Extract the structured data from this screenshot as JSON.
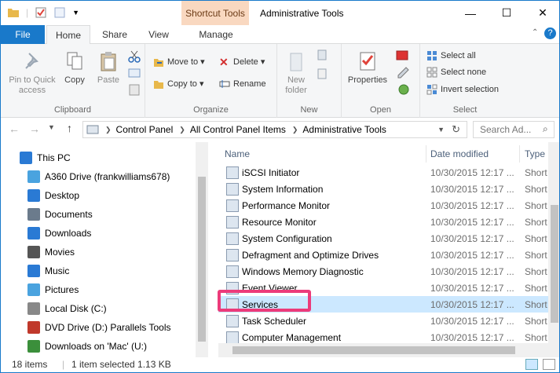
{
  "window": {
    "title": "Administrative Tools",
    "context_tab": "Shortcut Tools",
    "minimize": "—",
    "maximize": "☐",
    "close": "✕"
  },
  "tabs": [
    "File",
    "Home",
    "Share",
    "View",
    "Manage"
  ],
  "ribbon": {
    "clipboard": {
      "label": "Clipboard",
      "pin": "Pin to Quick access",
      "copy": "Copy",
      "paste": "Paste"
    },
    "organize": {
      "label": "Organize",
      "move_to": "Move to ▾",
      "copy_to": "Copy to ▾",
      "delete": "Delete ▾",
      "rename": "Rename"
    },
    "new": {
      "label": "New",
      "new_folder": "New folder"
    },
    "open": {
      "label": "Open",
      "properties": "Properties"
    },
    "select": {
      "label": "Select",
      "select_all": "Select all",
      "select_none": "Select none",
      "invert": "Invert selection"
    }
  },
  "address": {
    "crumbs": [
      "Control Panel",
      "All Control Panel Items",
      "Administrative Tools"
    ],
    "search_placeholder": "Search Ad..."
  },
  "nav": [
    {
      "label": "This PC",
      "icon": "pc-icon"
    },
    {
      "label": "A360 Drive (frankwilliams678)",
      "icon": "cloud-drive-icon"
    },
    {
      "label": "Desktop",
      "icon": "desktop-icon"
    },
    {
      "label": "Documents",
      "icon": "documents-icon"
    },
    {
      "label": "Downloads",
      "icon": "downloads-icon"
    },
    {
      "label": "Movies",
      "icon": "movies-icon"
    },
    {
      "label": "Music",
      "icon": "music-icon"
    },
    {
      "label": "Pictures",
      "icon": "pictures-icon"
    },
    {
      "label": "Local Disk (C:)",
      "icon": "disk-icon"
    },
    {
      "label": "DVD Drive (D:) Parallels Tools",
      "icon": "dvd-icon"
    },
    {
      "label": "Downloads on 'Mac' (U:)",
      "icon": "network-drive-icon"
    }
  ],
  "columns": {
    "name": "Name",
    "date": "Date modified",
    "type": "Type"
  },
  "files": [
    {
      "name": "iSCSI Initiator",
      "date": "10/30/2015 12:17 ...",
      "type": "Short"
    },
    {
      "name": "System Information",
      "date": "10/30/2015 12:17 ...",
      "type": "Short"
    },
    {
      "name": "Performance Monitor",
      "date": "10/30/2015 12:17 ...",
      "type": "Short"
    },
    {
      "name": "Resource Monitor",
      "date": "10/30/2015 12:17 ...",
      "type": "Short"
    },
    {
      "name": "System Configuration",
      "date": "10/30/2015 12:17 ...",
      "type": "Short"
    },
    {
      "name": "Defragment and Optimize Drives",
      "date": "10/30/2015 12:17 ...",
      "type": "Short"
    },
    {
      "name": "Windows Memory Diagnostic",
      "date": "10/30/2015 12:17 ...",
      "type": "Short"
    },
    {
      "name": "Event Viewer",
      "date": "10/30/2015 12:17 ...",
      "type": "Short"
    },
    {
      "name": "Services",
      "date": "10/30/2015 12:17 ...",
      "type": "Short"
    },
    {
      "name": "Task Scheduler",
      "date": "10/30/2015 12:17 ...",
      "type": "Short"
    },
    {
      "name": "Computer Management",
      "date": "10/30/2015 12:17 ...",
      "type": "Short"
    }
  ],
  "status": {
    "items": "18 items",
    "selected": "1 item selected  1.13 KB"
  },
  "colors": {
    "accent": "#1979ca",
    "selection": "#cce8ff",
    "highlight": "#ec3b7a"
  }
}
